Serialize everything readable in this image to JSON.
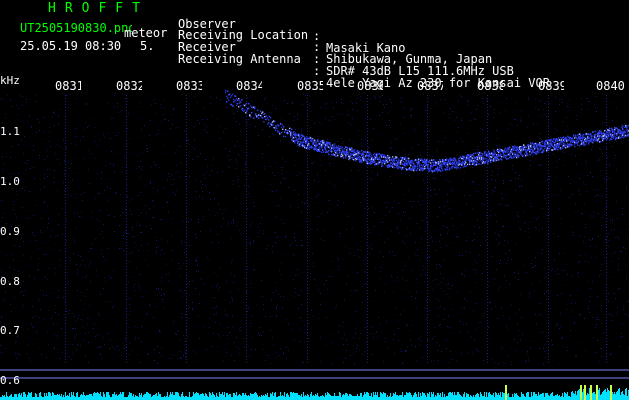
{
  "header": {
    "logo": "HROFFT",
    "filename": "UT2505190830.png",
    "mode": "meteor",
    "datetime": "25.05.19 08:30",
    "count": "5."
  },
  "info": [
    {
      "label": "Observer",
      "value": "Masaki Kano"
    },
    {
      "label": "Receiving Location",
      "value": "Shibukawa, Gunma, Japan"
    },
    {
      "label": "Receiver",
      "value": "SDR# 43dB L15 111.6MHz USB"
    },
    {
      "label": "Receiving Antenna",
      "value": "4ele Yagi Az 230 for Kansai VOR"
    }
  ],
  "info_colon": ":",
  "axis": {
    "unit": "kHz",
    "y_labels": [
      "1.1",
      "1.0",
      "0.9",
      "0.8",
      "0.7",
      "0.6"
    ],
    "time_labels": [
      "0831",
      "0832",
      "0833",
      "0834",
      "0835",
      "0836",
      "0837",
      "0838",
      "0839",
      "0840"
    ]
  },
  "colors": {
    "background": "#000000",
    "logo": "#00ff00",
    "text": "#ffffff",
    "signal": "#3344ff",
    "noise": "#00e0ff",
    "noise_peak": "#c8ff40",
    "reference_line": "#7a82ff"
  }
}
